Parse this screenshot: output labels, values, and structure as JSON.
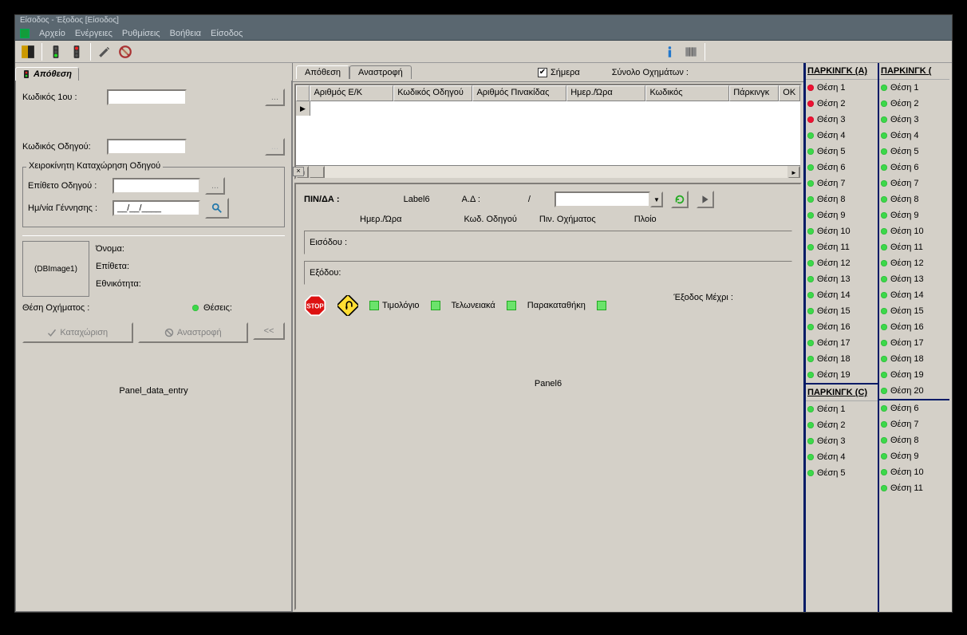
{
  "window": {
    "title": "Είσοδος - Έξοδος  [Είσοδος]"
  },
  "menu": {
    "items": [
      "Αρχείο",
      "Ενέργειες",
      "Ρυθμίσεις",
      "Βοήθεια",
      "Είσοδος"
    ]
  },
  "left": {
    "tab_label": "Απόθεση",
    "code1_label": "Κωδικός 1ου :",
    "code1_btn": "...",
    "driver_code_label": "Κωδικός Οδηγού:",
    "driver_code_btn": "...",
    "manual_group": "Χειροκίνητη Καταχώρηση Οδηγού",
    "driver_surname_label": "Επίθετο Οδηγού :",
    "driver_surname_btn": "...",
    "dob_label": "Ημ/νία Γέννησης :",
    "dob_value": "__/__/____",
    "name_label": "Όνομα:",
    "surname_label": "Επίθετα:",
    "nationality_label": "Εθνικότητα:",
    "dbimage": "(DBImage1)",
    "vehicle_pos_label": "Θέση Οχήματος :",
    "positions_label": "Θέσεις:",
    "btn_save": "Καταχώριση",
    "btn_reverse": "Αναστροφή",
    "btn_back": "<<",
    "panel_label": "Panel_data_entry"
  },
  "center": {
    "tab_apothesi": "Απόθεση",
    "tab_anastrofi": "Αναστροφή",
    "chk_today": "Σήμερα",
    "total_label": "Σύνολο Οχημάτων :",
    "grid_columns": [
      "Αριθμός Ε/Κ",
      "Κωδικός Οδηγού",
      "Αριθμός Πινακίδας",
      "Ημερ./Ώρα",
      "Κωδικός",
      "Πάρκινγκ",
      "OK"
    ],
    "pin_label": "ΠΙΝ/ΔΑ :",
    "label6": "Label6",
    "ad_label": "Α.Δ :",
    "slash": "/",
    "col_hdrs": [
      "Ημερ./Ώρα",
      "Κωδ. Οδηγού",
      "Πιν. Οχήματος",
      "Πλοίο"
    ],
    "entry_label": "Εισόδου :",
    "exit_label": "Εξόδου:",
    "exit_until": "Έξοδος Μέχρι :",
    "flag_invoice": "Τιμολόγιο",
    "flag_customs": "Τελωνειακά",
    "flag_deposit": "Παρακαταθήκη",
    "panel6": "Panel6"
  },
  "parking": {
    "colA": {
      "title": "ΠΑΡΚΙΝΓΚ (A)",
      "slots": [
        {
          "n": "Θέση 1",
          "s": "red"
        },
        {
          "n": "Θέση 2",
          "s": "red"
        },
        {
          "n": "Θέση 3",
          "s": "red"
        },
        {
          "n": "Θέση 4",
          "s": "green"
        },
        {
          "n": "Θέση 5",
          "s": "green"
        },
        {
          "n": "Θέση 6",
          "s": "green"
        },
        {
          "n": "Θέση 7",
          "s": "green"
        },
        {
          "n": "Θέση 8",
          "s": "green"
        },
        {
          "n": "Θέση 9",
          "s": "green"
        },
        {
          "n": "Θέση 10",
          "s": "green"
        },
        {
          "n": "Θέση 11",
          "s": "green"
        },
        {
          "n": "Θέση 12",
          "s": "green"
        },
        {
          "n": "Θέση 13",
          "s": "green"
        },
        {
          "n": "Θέση 14",
          "s": "green"
        },
        {
          "n": "Θέση 15",
          "s": "green"
        },
        {
          "n": "Θέση 16",
          "s": "green"
        },
        {
          "n": "Θέση 17",
          "s": "green"
        },
        {
          "n": "Θέση 18",
          "s": "green"
        },
        {
          "n": "Θέση 19",
          "s": "green"
        }
      ]
    },
    "colC": {
      "title": "ΠΑΡΚΙΝΓΚ (C)",
      "slots": [
        {
          "n": "Θέση 1",
          "s": "green"
        },
        {
          "n": "Θέση 2",
          "s": "green"
        },
        {
          "n": "Θέση 3",
          "s": "green"
        },
        {
          "n": "Θέση 4",
          "s": "green"
        },
        {
          "n": "Θέση 5",
          "s": "green"
        }
      ]
    },
    "colB1": {
      "title": "ΠΑΡΚΙΝΓΚ (",
      "slots": [
        {
          "n": "Θέση 1",
          "s": "green"
        },
        {
          "n": "Θέση 2",
          "s": "green"
        },
        {
          "n": "Θέση 3",
          "s": "green"
        },
        {
          "n": "Θέση 4",
          "s": "green"
        },
        {
          "n": "Θέση 5",
          "s": "green"
        },
        {
          "n": "Θέση 6",
          "s": "green"
        },
        {
          "n": "Θέση 7",
          "s": "green"
        },
        {
          "n": "Θέση 8",
          "s": "green"
        },
        {
          "n": "Θέση 9",
          "s": "green"
        },
        {
          "n": "Θέση 10",
          "s": "green"
        },
        {
          "n": "Θέση 11",
          "s": "green"
        },
        {
          "n": "Θέση 12",
          "s": "green"
        },
        {
          "n": "Θέση 13",
          "s": "green"
        },
        {
          "n": "Θέση 14",
          "s": "green"
        },
        {
          "n": "Θέση 15",
          "s": "green"
        },
        {
          "n": "Θέση 16",
          "s": "green"
        },
        {
          "n": "Θέση 17",
          "s": "green"
        },
        {
          "n": "Θέση 18",
          "s": "green"
        },
        {
          "n": "Θέση 19",
          "s": "green"
        },
        {
          "n": "Θέση 20",
          "s": "green"
        }
      ]
    },
    "colB2": {
      "slots": [
        {
          "n": "Θέση 6",
          "s": "green"
        },
        {
          "n": "Θέση 7",
          "s": "green"
        },
        {
          "n": "Θέση 8",
          "s": "green"
        },
        {
          "n": "Θέση 9",
          "s": "green"
        },
        {
          "n": "Θέση 10",
          "s": "green"
        },
        {
          "n": "Θέση 11",
          "s": "green"
        }
      ]
    }
  }
}
